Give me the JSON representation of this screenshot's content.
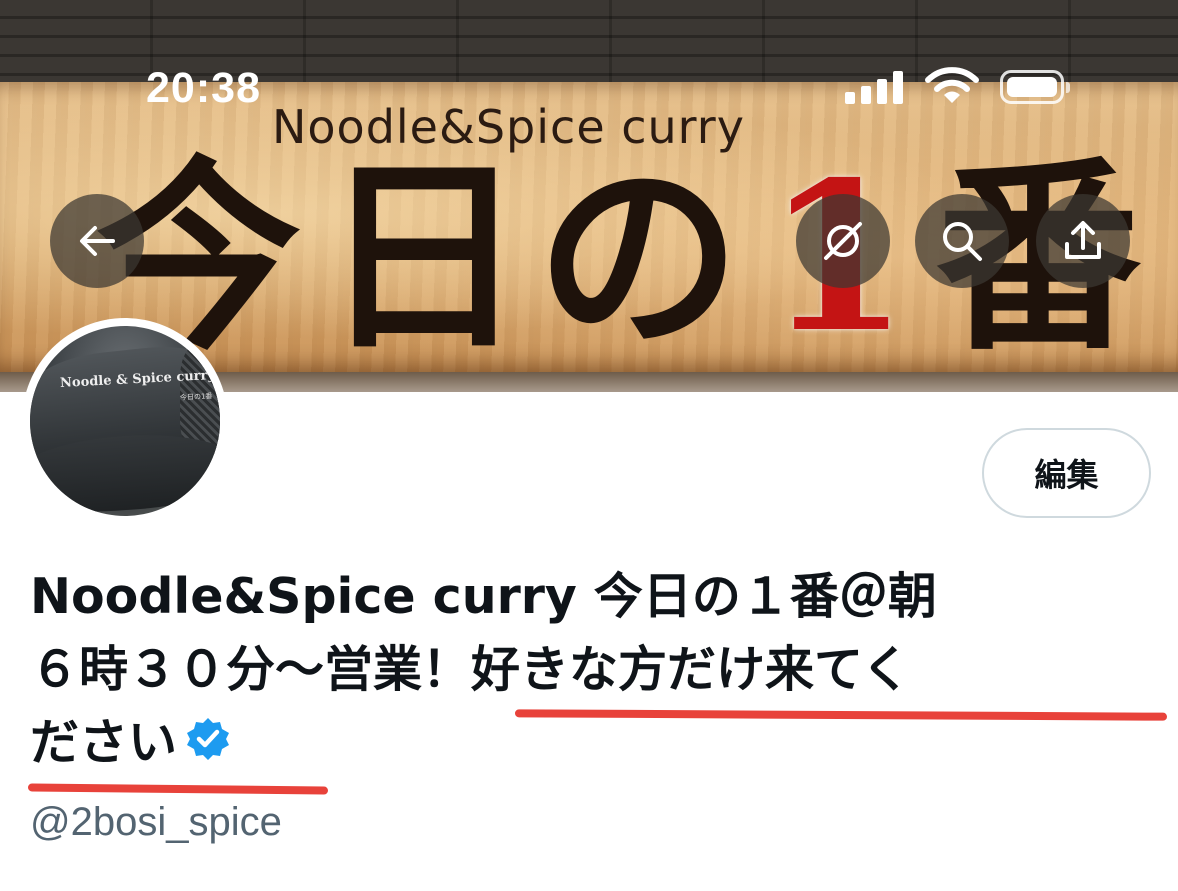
{
  "status_bar": {
    "time": "20:38"
  },
  "banner": {
    "sign_subtitle": "Noodle&Spice curry",
    "sign_chars": [
      "今",
      "日",
      "の",
      "1",
      "番"
    ]
  },
  "header_buttons": {
    "back": "back-arrow-icon",
    "grok": "grok-icon",
    "search": "search-icon",
    "share": "share-icon"
  },
  "avatar": {
    "cap_text": "Noodle & Spice curry",
    "cap_subtext": "今日の1番"
  },
  "profile": {
    "edit_label": "編集",
    "name_line1": "Noodle&Spice curry 今日の１番＠朝",
    "name_line2": "６時３０分〜営業！好きな方だけ来てく",
    "name_line3": "ださい",
    "handle": "@2bosi_spice",
    "verified": true
  },
  "colors": {
    "verified_blue": "#1d9bf0",
    "underline_red": "#e8423a",
    "text_primary": "#0f1419",
    "text_secondary": "#536471"
  }
}
